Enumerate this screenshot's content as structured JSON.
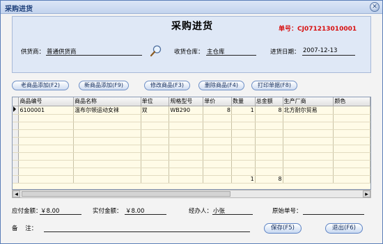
{
  "window": {
    "title": "采购进货",
    "close_glyph": "✕"
  },
  "header": {
    "title": "采购进货",
    "order_no_label": "单号：",
    "order_no": "CJ071213010001",
    "supplier_label": "供货商：",
    "supplier_value": "普通供货商",
    "warehouse_label": "收货仓库：",
    "warehouse_value": "主仓库",
    "date_label": "进货日期：",
    "date_value": "2007-12-13"
  },
  "toolbar": {
    "buttons": [
      "老商品添加(F2)",
      "新商品添加(F9)",
      "修改商品(F3)",
      "删除商品(F4)",
      "打印单据(F8)"
    ]
  },
  "grid": {
    "columns": [
      "商品编号",
      "商品名称",
      "单位",
      "规格型号",
      "单价",
      "数量",
      "总金额",
      "生产厂商",
      "颜色"
    ],
    "rows": [
      [
        "6100001",
        "温布尔顿运动女袜",
        "双",
        "WB290",
        "8",
        "1",
        "8",
        "北方耐尔贸易",
        ""
      ]
    ],
    "totals": {
      "quantity": "1",
      "amount": "8"
    }
  },
  "summary": {
    "payable_label": "应付金额：",
    "payable_value": "￥8.00",
    "paid_label": "实付金额：",
    "paid_value": "￥8.00",
    "handler_label": "经办人：",
    "handler_value": "小张",
    "original_no_label": "原始单号：",
    "original_no_value": "",
    "remark_label": "备    注：",
    "remark_value": ""
  },
  "actions": {
    "save": "保存(F5)",
    "exit": "退出(F6)"
  },
  "colors": {
    "order_no": "#d80f0f",
    "panel": "#dfe8f6",
    "grid_bg": "#fffbe7"
  }
}
